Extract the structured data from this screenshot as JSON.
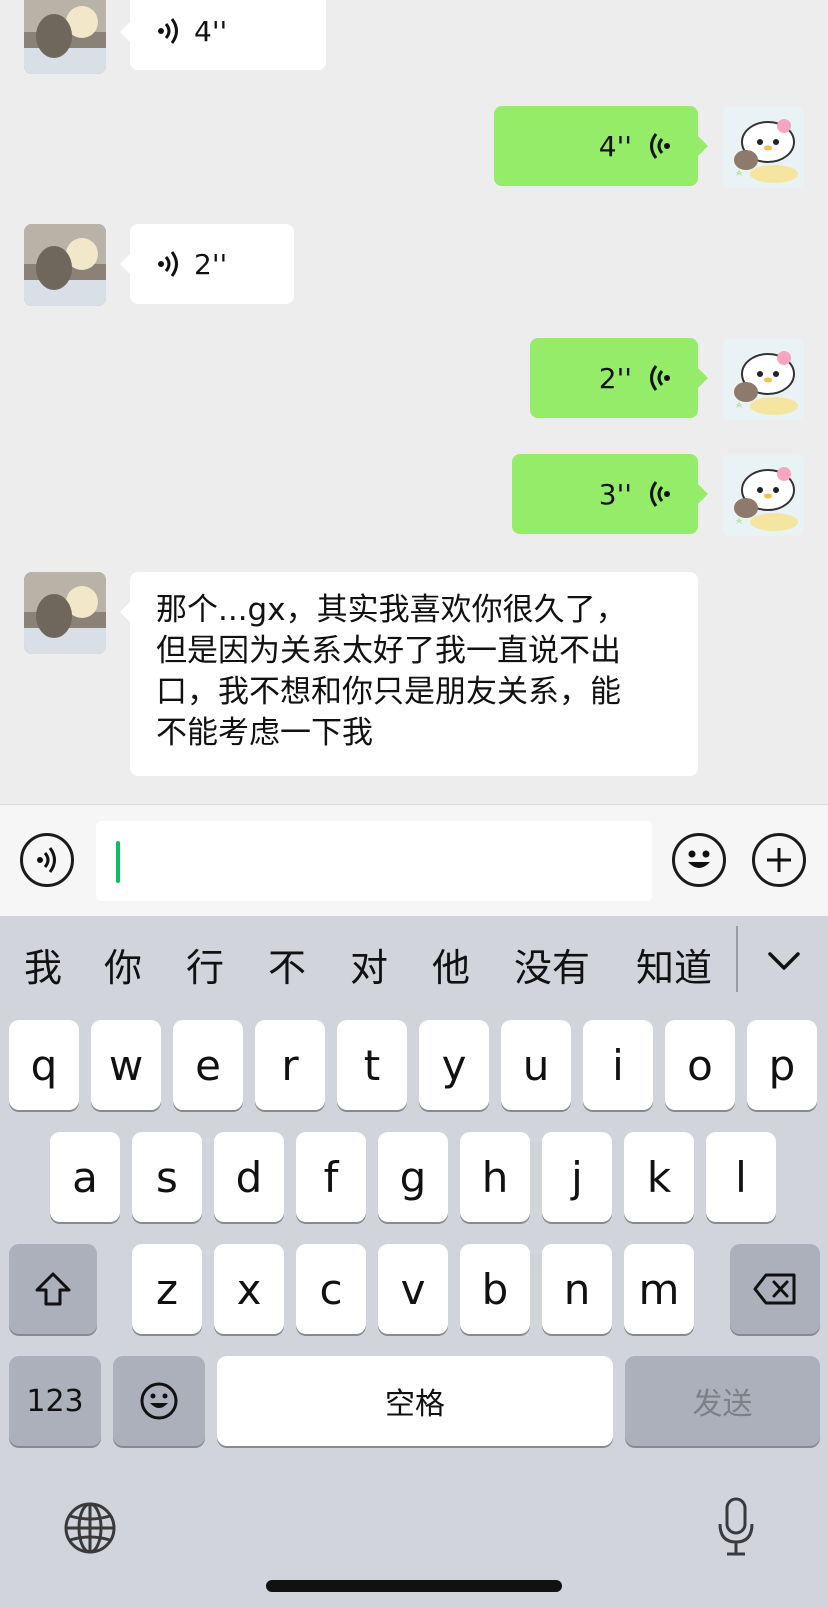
{
  "messages": [
    {
      "side": "left",
      "type": "voice",
      "duration": "4''"
    },
    {
      "side": "right",
      "type": "voice",
      "duration": "4''"
    },
    {
      "side": "left",
      "type": "voice",
      "duration": "2''"
    },
    {
      "side": "right",
      "type": "voice",
      "duration": "2''"
    },
    {
      "side": "right",
      "type": "voice",
      "duration": "3''"
    },
    {
      "side": "left",
      "type": "text",
      "lines": [
        "那个...gx，其实我喜欢你很久了，",
        "但是因为关系太好了我一直说不出",
        "口，我不想和你只是朋友关系，能",
        "不能考虑一下我"
      ]
    }
  ],
  "input_bar": {
    "voice_icon": "voice-mode-icon",
    "input_value": "",
    "emoji_icon": "emoji-icon",
    "plus_icon": "plus-icon"
  },
  "keyboard": {
    "candidates": [
      "我",
      "你",
      "行",
      "不",
      "对",
      "他",
      "没有",
      "知道"
    ],
    "rows": [
      [
        "q",
        "w",
        "e",
        "r",
        "t",
        "y",
        "u",
        "i",
        "o",
        "p"
      ],
      [
        "a",
        "s",
        "d",
        "f",
        "g",
        "h",
        "j",
        "k",
        "l"
      ],
      [
        "z",
        "x",
        "c",
        "v",
        "b",
        "n",
        "m"
      ]
    ],
    "num_key": "123",
    "space_key": "空格",
    "send_key": "发送",
    "icons": [
      "shift-icon",
      "backspace-icon",
      "emoji-icon",
      "globe-icon",
      "microphone-icon",
      "chevron-down-icon"
    ]
  },
  "colors": {
    "incoming_bubble": "#ffffff",
    "outgoing_bubble": "#95ec69",
    "caret": "#07c160",
    "chat_bg": "#ededed",
    "keyboard_bg": "#d1d4da"
  }
}
